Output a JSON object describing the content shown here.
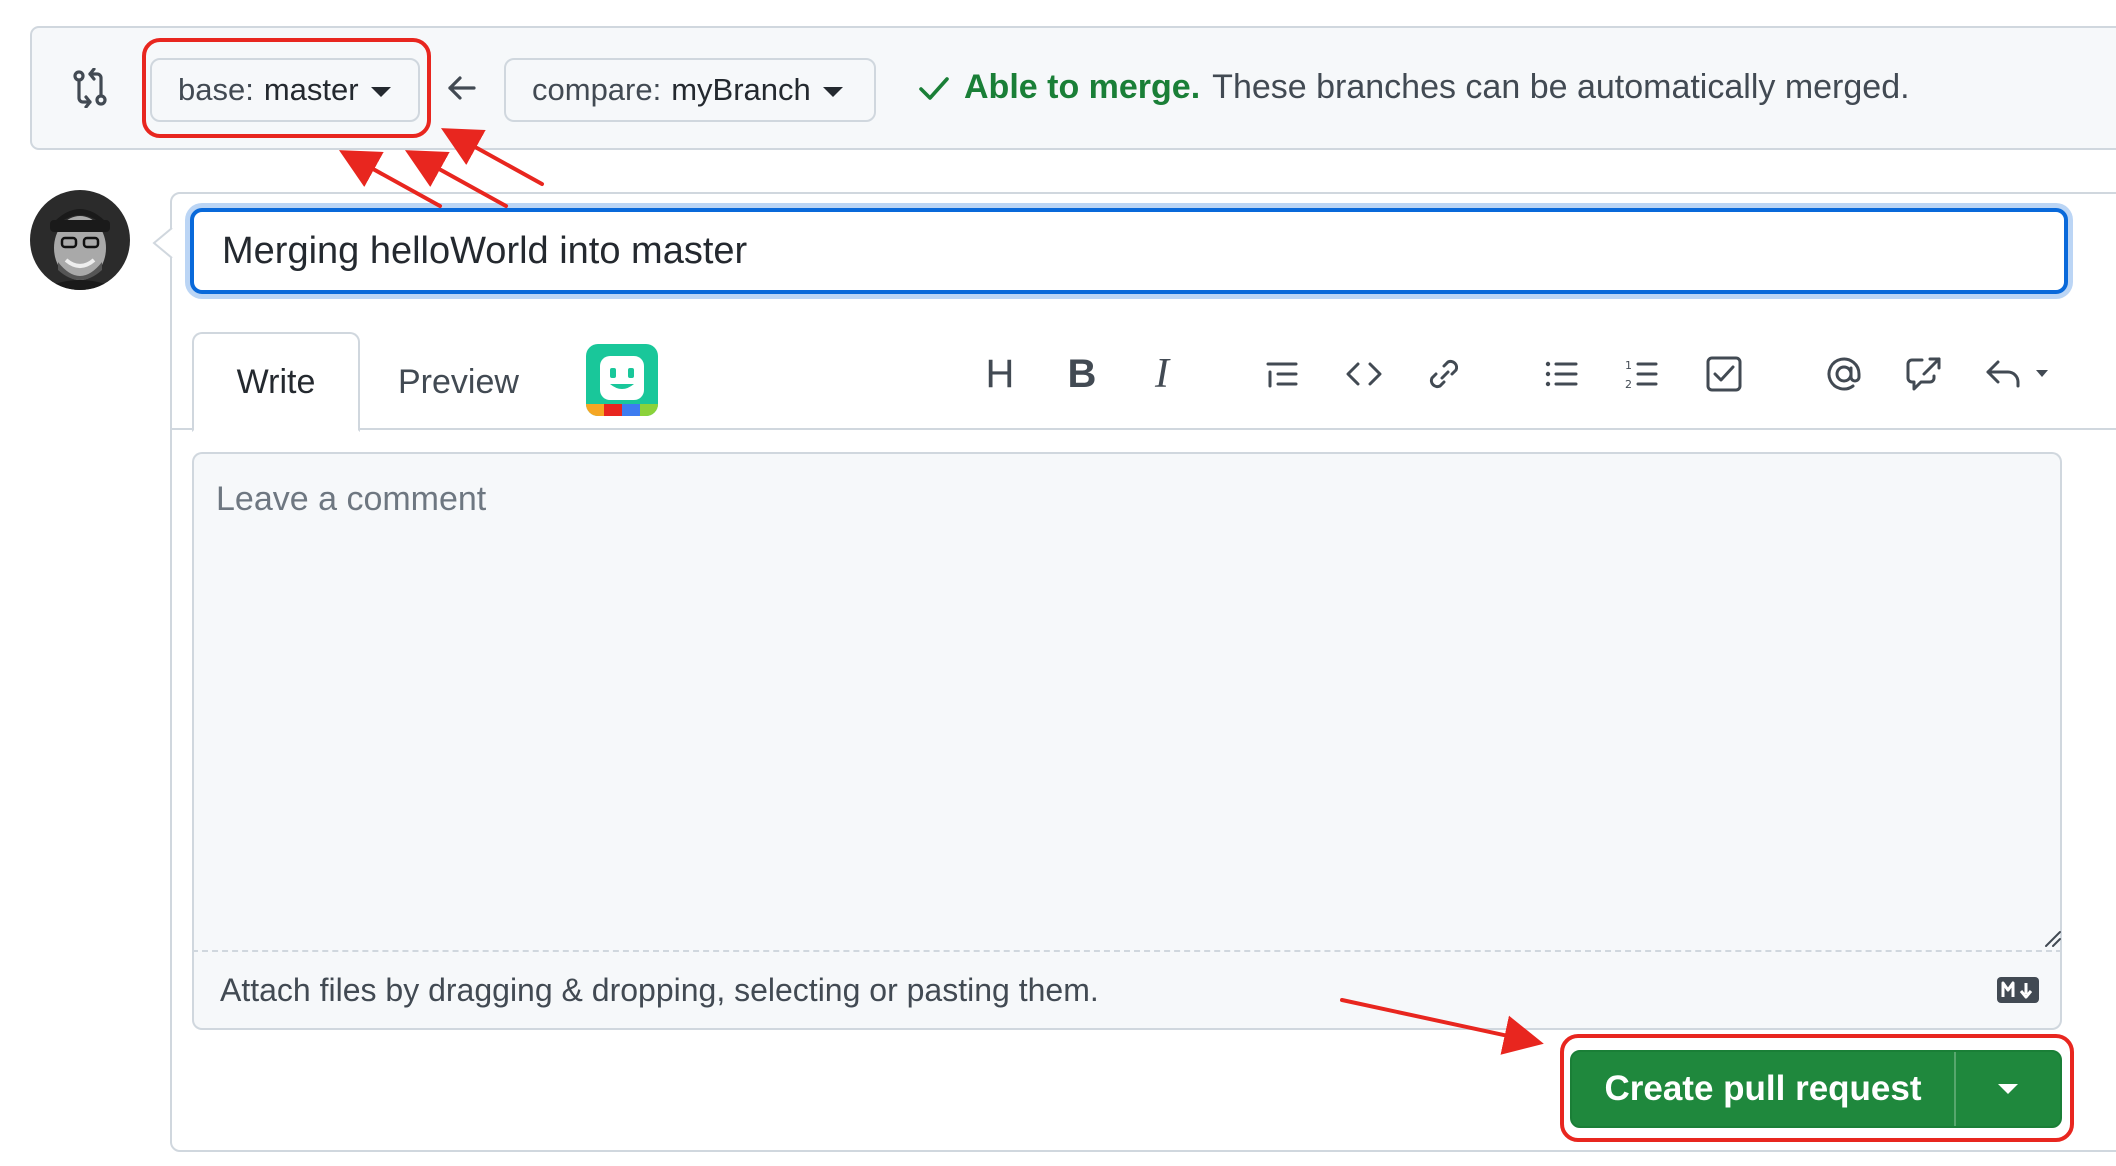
{
  "range_bar": {
    "base_label": "base:",
    "base_value": "master",
    "compare_label": "compare:",
    "compare_value": "myBranch",
    "merge_ok": "Able to merge.",
    "merge_message": "These branches can be automatically merged."
  },
  "pr_form": {
    "title_value": "Merging helloWorld into master",
    "tabs": [
      {
        "label": "Write"
      },
      {
        "label": "Preview"
      }
    ],
    "comment_placeholder": "Leave a comment",
    "attach_text": "Attach files by dragging & dropping, selecting or pasting them.",
    "toolbar_icons": [
      "heading-icon",
      "bold-icon",
      "italic-icon",
      "quote-icon",
      "code-icon",
      "link-icon",
      "unordered-list-icon",
      "ordered-list-icon",
      "task-list-icon",
      "mention-icon",
      "reference-icon",
      "saved-replies-icon"
    ],
    "create_label": "Create pull request"
  },
  "colors": {
    "accent_blue": "#0969da",
    "success_green": "#1a7f37",
    "button_green": "#1f883d",
    "annotation_red": "#e8261f"
  }
}
